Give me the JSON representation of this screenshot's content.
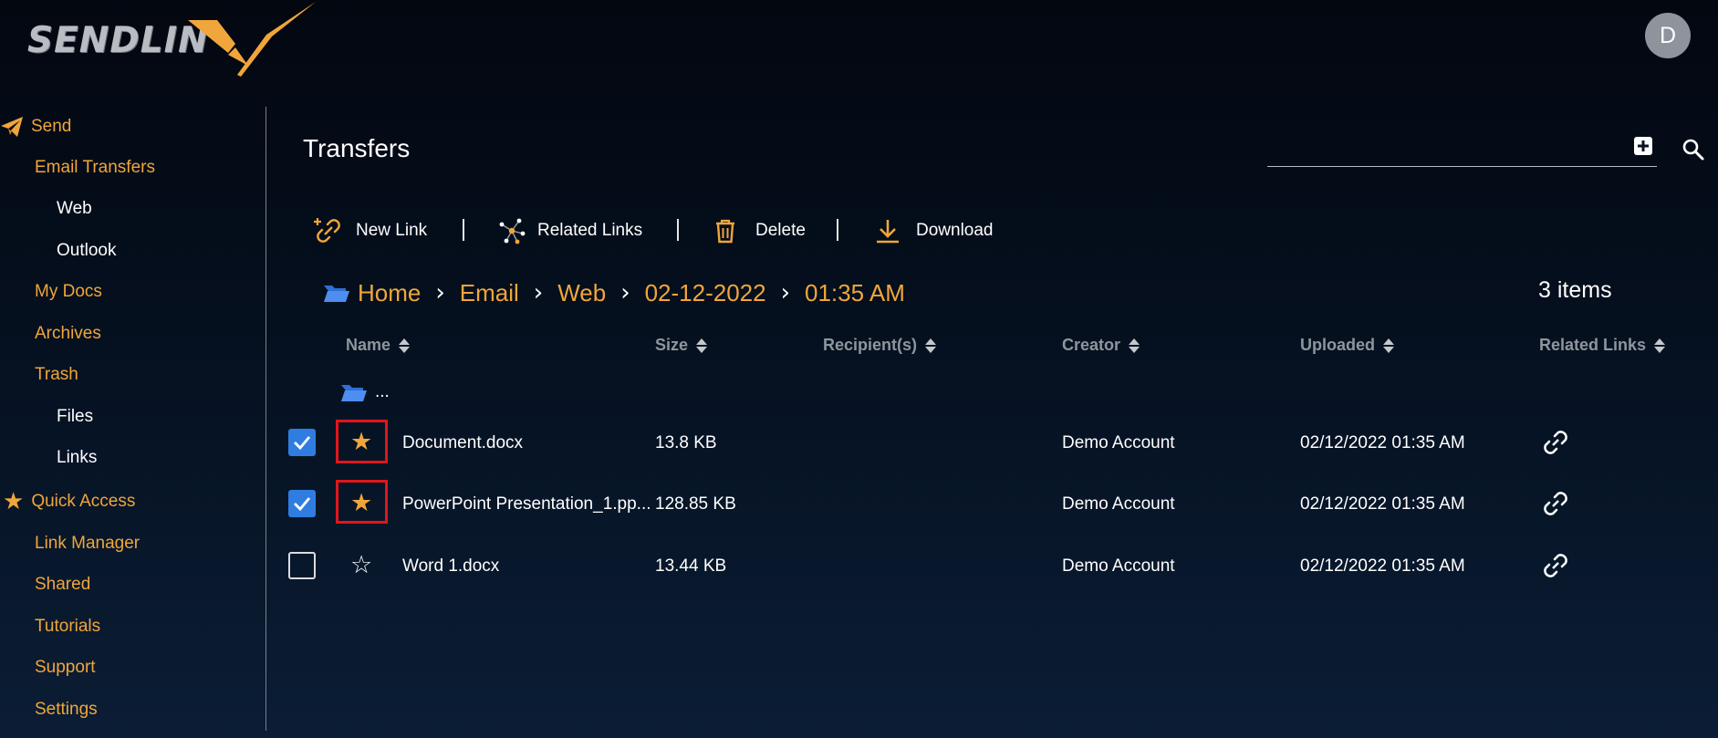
{
  "app": {
    "logo_text": "SENDLIN",
    "logo_accent": "X",
    "avatar_initial": "D"
  },
  "colors": {
    "accent": "#f0a63a",
    "checkbox": "#2f7de1",
    "highlight": "#e0161b",
    "folder": "#4d8ef0"
  },
  "sidebar": {
    "send": "Send",
    "email_transfers": "Email Transfers",
    "web": "Web",
    "outlook": "Outlook",
    "my_docs": "My Docs",
    "archives": "Archives",
    "trash": "Trash",
    "files": "Files",
    "links": "Links",
    "quick_access": "Quick Access",
    "link_manager": "Link Manager",
    "shared": "Shared",
    "tutorials": "Tutorials",
    "support": "Support",
    "settings": "Settings"
  },
  "main": {
    "title": "Transfers",
    "search_value": "",
    "toolbar": {
      "new_link": "New Link",
      "related_links": "Related Links",
      "delete": "Delete",
      "download": "Download"
    },
    "breadcrumb": [
      "Home",
      "Email",
      "Web",
      "02-12-2022",
      "01:35 AM"
    ],
    "items_count": "3 items",
    "columns": {
      "name": "Name",
      "size": "Size",
      "recipients": "Recipient(s)",
      "creator": "Creator",
      "uploaded": "Uploaded",
      "related_links": "Related Links"
    },
    "parent_label": "...",
    "rows": [
      {
        "name": "Document.docx",
        "size": "13.8 KB",
        "recipients": "",
        "creator": "Demo Account",
        "uploaded": "02/12/2022 01:35 AM",
        "checked": true,
        "starred": true
      },
      {
        "name": "PowerPoint Presentation_1.pp...",
        "size": "128.85 KB",
        "recipients": "",
        "creator": "Demo Account",
        "uploaded": "02/12/2022 01:35 AM",
        "checked": true,
        "starred": true
      },
      {
        "name": "Word 1.docx",
        "size": "13.44 KB",
        "recipients": "",
        "creator": "Demo Account",
        "uploaded": "02/12/2022 01:35 AM",
        "checked": false,
        "starred": false
      }
    ]
  }
}
